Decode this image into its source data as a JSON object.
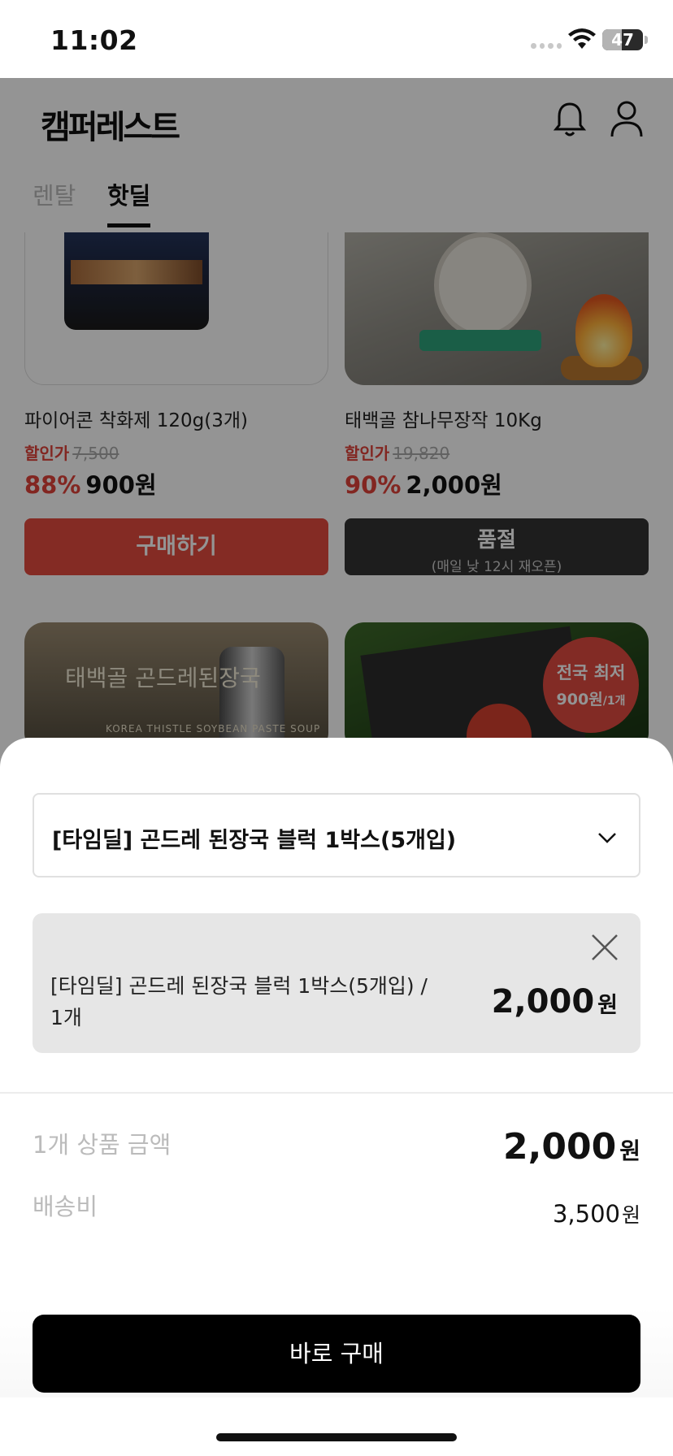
{
  "status_bar": {
    "time": "11:02",
    "battery": "47",
    "battery_level": 0.47
  },
  "header": {
    "logo_text": "캠퍼레스트"
  },
  "tabs": [
    {
      "label": "렌탈",
      "active": false
    },
    {
      "label": "핫딜",
      "active": true
    }
  ],
  "products": [
    {
      "name": "파이어콘 착화제 120g(3개)",
      "sale_label": "할인가",
      "original_price": "7,500",
      "discount": "88%",
      "price": "900원",
      "button_label": "구매하기"
    },
    {
      "name": "태백골 참나무장작 10Kg",
      "sale_label": "할인가",
      "original_price": "19,820",
      "discount": "90%",
      "price": "2,000원",
      "button_label": "품절",
      "button_sublabel": "(매일 낮 12시 재오픈)"
    }
  ],
  "banners": [
    {
      "title": "태백골 곤드레된장국",
      "subtitle": "KOREA THISTLE SOYBEAN PASTE SOUP"
    },
    {
      "badge_line1": "전국 최저",
      "badge_price": "900원",
      "badge_unit": "/1개"
    }
  ],
  "sheet": {
    "option_selected": "[타임딜] 곤드레 된장국 블럭 1박스(5개입)",
    "selected_item": {
      "name": "[타임딜] 곤드레 된장국 블럭 1박스(5개입) / 1개",
      "price": "2,000",
      "unit": "원"
    },
    "summary": {
      "amount_label": "1개 상품 금액",
      "amount_value": "2,000",
      "amount_unit": "원",
      "shipping_label": "배송비",
      "shipping_value": "3,500",
      "shipping_unit": "원"
    },
    "buy_button": "바로 구매"
  },
  "colors": {
    "accent": "#e44a3f",
    "soldout": "#333333",
    "cta": "#000000"
  },
  "icons": [
    "wifi-icon",
    "battery-icon",
    "bell-icon",
    "user-icon",
    "chevron-down-icon",
    "close-icon"
  ]
}
